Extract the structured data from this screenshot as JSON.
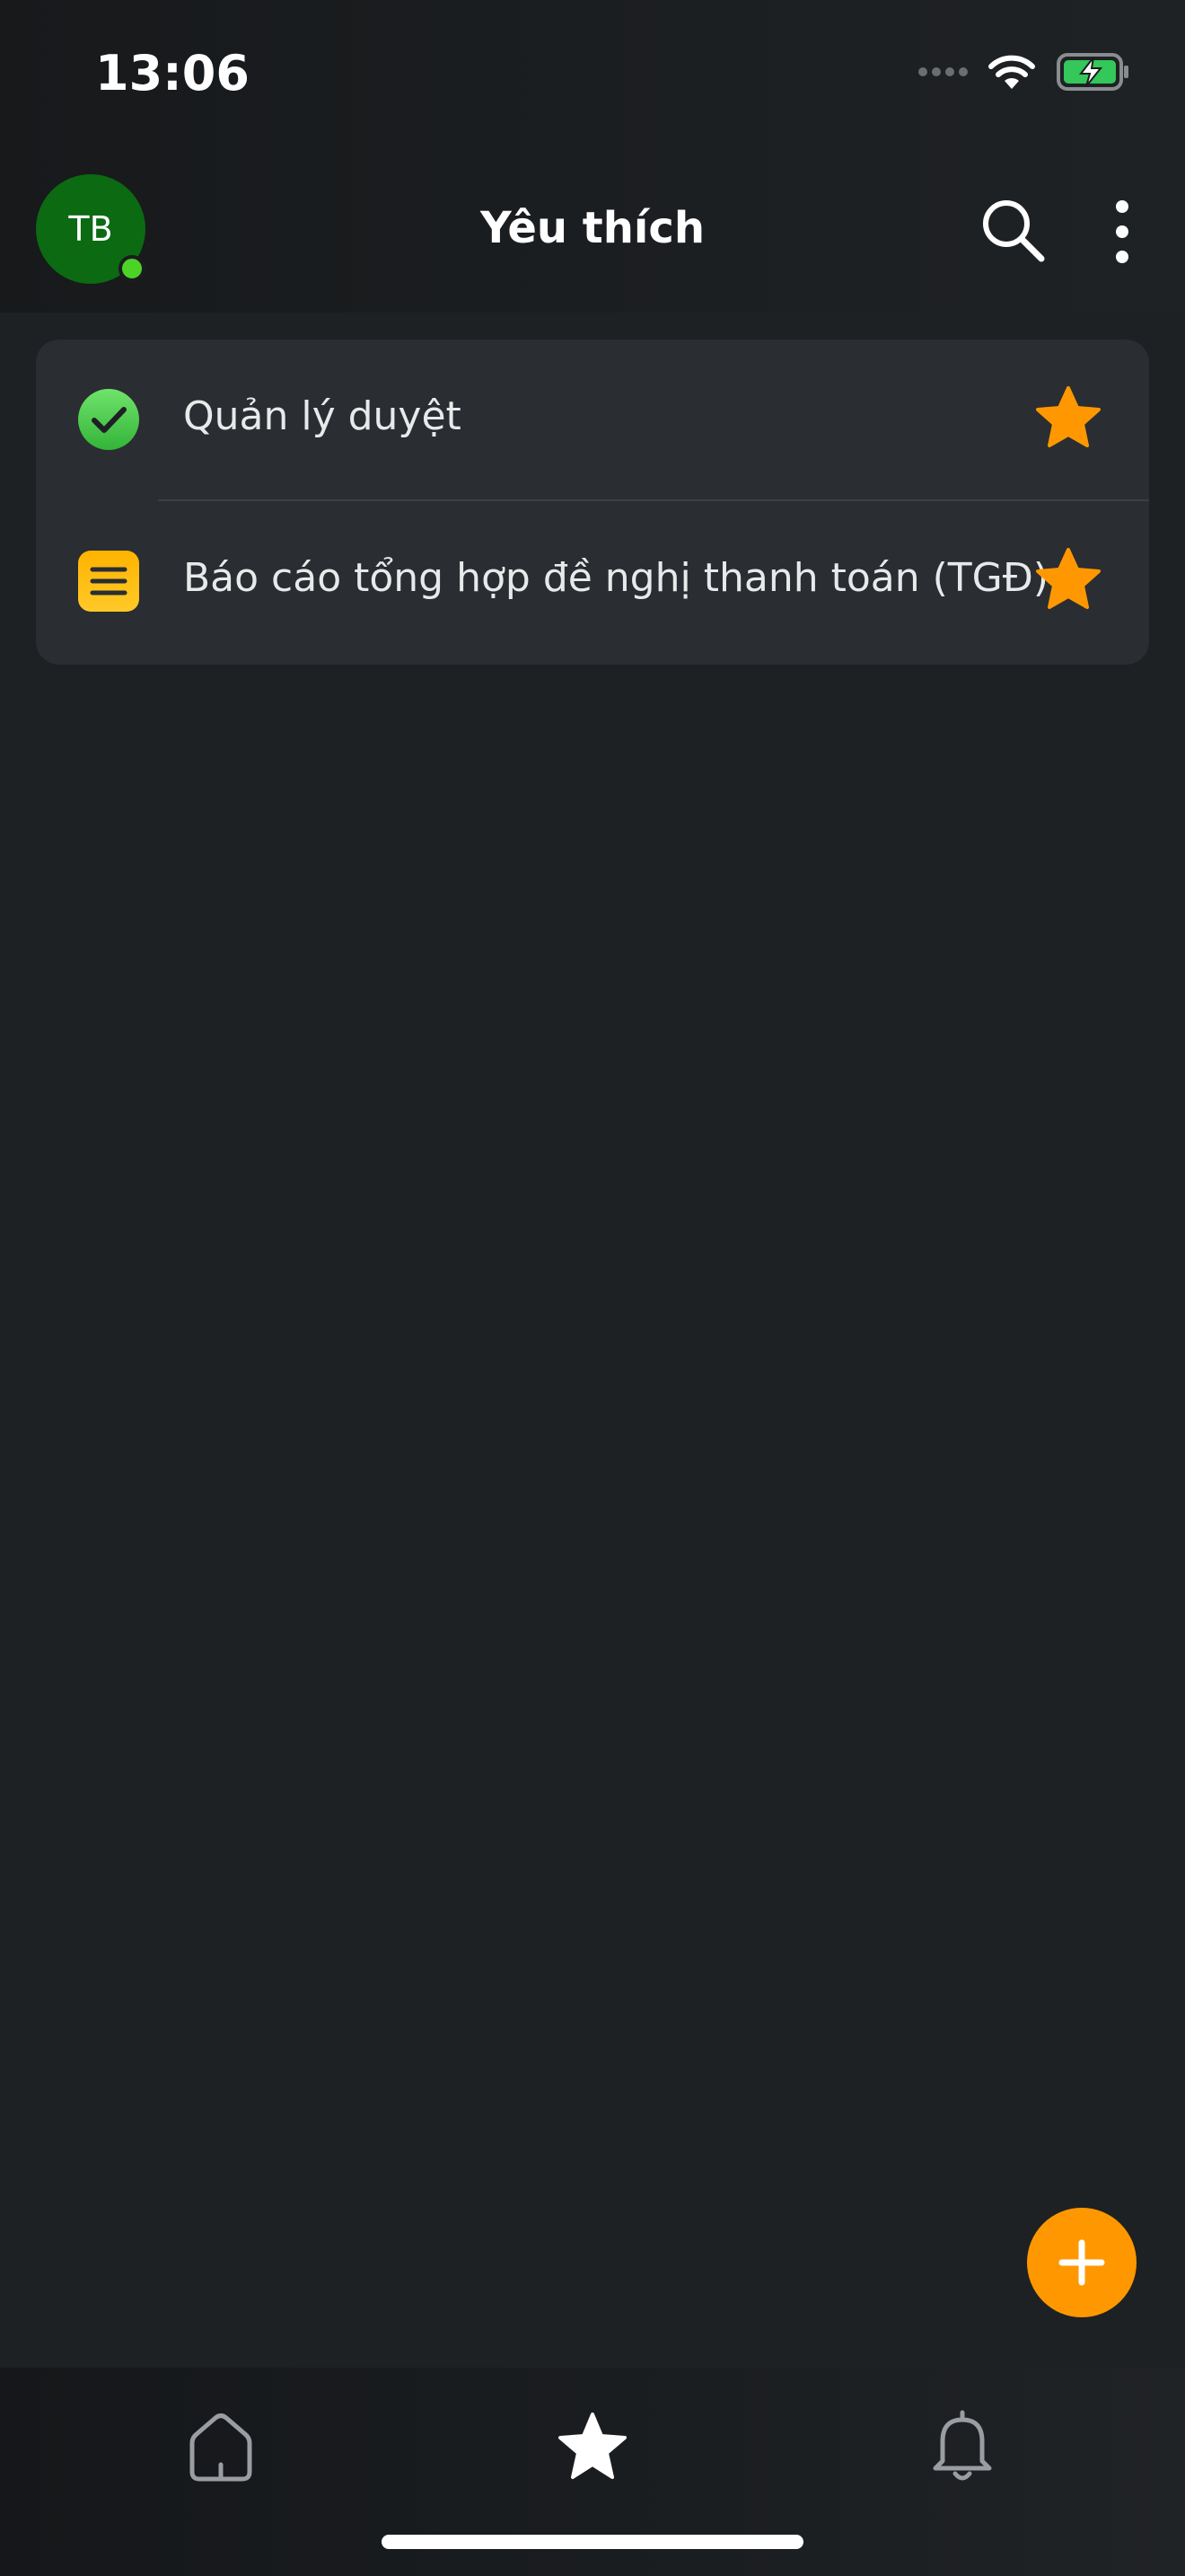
{
  "status_bar": {
    "time": "13:06"
  },
  "header": {
    "avatar_initials": "TB",
    "title": "Yêu thích"
  },
  "favorites": [
    {
      "label": "Quản lý duyệt",
      "icon": "check-circle-icon",
      "icon_color": "#4cd327",
      "starred": true
    },
    {
      "label": "Báo cáo tổng hợp đề nghị thanh toán (TGĐ)",
      "icon": "list-document-icon",
      "icon_color": "#ffb300",
      "starred": true
    }
  ],
  "tabs": [
    {
      "name": "home",
      "icon": "home-icon",
      "active": false
    },
    {
      "name": "favorites",
      "icon": "star-icon",
      "active": true
    },
    {
      "name": "notifications",
      "icon": "bell-icon",
      "active": false
    }
  ],
  "colors": {
    "background": "#1e2124",
    "card": "#2a2d31",
    "accent": "#ff9800",
    "avatar": "#0b6a12",
    "online": "#4cd327"
  }
}
